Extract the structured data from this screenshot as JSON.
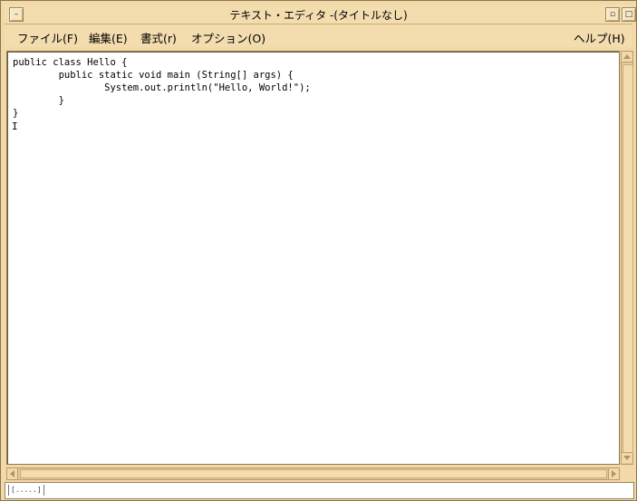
{
  "window": {
    "title": "テキスト・エディタ -(タイトルなし)",
    "menu_button_glyph": "–",
    "minimize_glyph": "▫",
    "maximize_glyph": "□"
  },
  "menubar": {
    "items": [
      {
        "label": "ファイル(F)"
      },
      {
        "label": "編集(E)"
      },
      {
        "label": "書式(r)"
      },
      {
        "label": "オプション(O)"
      }
    ],
    "help_label": "ヘルプ(H)"
  },
  "editor": {
    "content": "public class Hello {\n        public static void main (String[] args) {\n                System.out.println(\"Hello, World!\");\n        }\n}",
    "cursor_glyph": "I"
  },
  "status": {
    "field_text": "[.....]"
  },
  "colors": {
    "chrome": "#f3dcae",
    "scroll_track": "#e7c994",
    "editor_bg": "#ffffff"
  }
}
